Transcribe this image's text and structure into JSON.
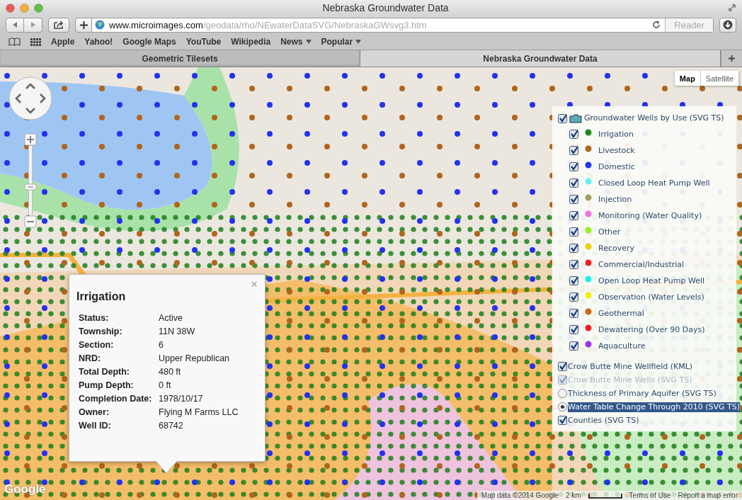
{
  "window": {
    "title": "Nebraska Groundwater Data"
  },
  "toolbar": {
    "url_host": "www.microimages.com",
    "url_path": "/geodata/rho/NEwaterDataSVG/NebraskaGWsvg3.htm",
    "reader": "Reader"
  },
  "bookmarks": [
    {
      "label": "Apple",
      "menu": false
    },
    {
      "label": "Yahoo!",
      "menu": false
    },
    {
      "label": "Google Maps",
      "menu": false
    },
    {
      "label": "YouTube",
      "menu": false
    },
    {
      "label": "Wikipedia",
      "menu": false
    },
    {
      "label": "News",
      "menu": true
    },
    {
      "label": "Popular",
      "menu": true
    }
  ],
  "tabs": [
    {
      "label": "Geometric Tilesets",
      "selected": false
    },
    {
      "label": "Nebraska Groundwater Data",
      "selected": true
    }
  ],
  "map": {
    "zoom": {
      "level": 0.4
    },
    "map_types": [
      {
        "label": "Map",
        "selected": true
      },
      {
        "label": "Satellite",
        "selected": false
      }
    ],
    "legend": {
      "group": {
        "label": "Groundwater Wells by Use (SVG TS)",
        "checked": true
      },
      "items": [
        {
          "label": "Irrigation",
          "checked": true,
          "color": "#1a8a1a"
        },
        {
          "label": "Livestock",
          "checked": true,
          "color": "#b0651c"
        },
        {
          "label": "Domestic",
          "checked": true,
          "color": "#2233ee"
        },
        {
          "label": "Closed Loop Heat Pump Well",
          "checked": true,
          "color": "#66eeee"
        },
        {
          "label": "Injection",
          "checked": true,
          "color": "#a0a060"
        },
        {
          "label": "Monitoring (Water Quality)",
          "checked": true,
          "color": "#f070e0"
        },
        {
          "label": "Other",
          "checked": true,
          "color": "#99ee22"
        },
        {
          "label": "Recovery",
          "checked": true,
          "color": "#f0cc00"
        },
        {
          "label": "Commercial/Industrial",
          "checked": true,
          "color": "#ee2222"
        },
        {
          "label": "Open Loop Heat Pump Well",
          "checked": true,
          "color": "#22eeee"
        },
        {
          "label": "Observation (Water Levels)",
          "checked": true,
          "color": "#f0f000"
        },
        {
          "label": "Geothermal",
          "checked": true,
          "color": "#cc6611"
        },
        {
          "label": "Dewatering (Over 90 Days)",
          "checked": true,
          "color": "#ee2222"
        },
        {
          "label": "Aquaculture",
          "checked": true,
          "color": "#9933ee"
        }
      ],
      "layers": [
        {
          "label": "Crow Butte Mine Wellfield (KML)",
          "kind": "checkbox",
          "checked": true,
          "disabled": false
        },
        {
          "label": "Crow Butte Mine Wells (SVG TS)",
          "kind": "checkbox",
          "checked": true,
          "disabled": true
        },
        {
          "label": "Thickness of Primary Aquifer (SVG TS)",
          "kind": "radio",
          "selected": false
        },
        {
          "label": "Water Table Change Through 2010 (SVG TS)",
          "kind": "radio",
          "selected": true
        },
        {
          "label": "Counties (SVG TS)",
          "kind": "checkbox",
          "checked": true,
          "disabled": false
        }
      ]
    },
    "popup": {
      "title": "Irrigation",
      "close": "×",
      "fields": [
        {
          "label": "Status:",
          "value": "Active"
        },
        {
          "label": "Township:",
          "value": "11N 38W"
        },
        {
          "label": "Section:",
          "value": "6"
        },
        {
          "label": "NRD:",
          "value": "Upper Republican"
        },
        {
          "label": "Total Depth:",
          "value": "480 ft"
        },
        {
          "label": "Pump Depth:",
          "value": "0 ft"
        },
        {
          "label": "Completion Date:",
          "value": "1978/10/17"
        },
        {
          "label": "Owner:",
          "value": "Flying M Farms LLC"
        },
        {
          "label": "Well ID:",
          "value": "68742"
        }
      ]
    },
    "logo": "Google",
    "attribution": {
      "data": "Map data ©2014 Google",
      "scale": "2 km",
      "terms": "Terms of Use",
      "report": "Report a map error"
    }
  }
}
